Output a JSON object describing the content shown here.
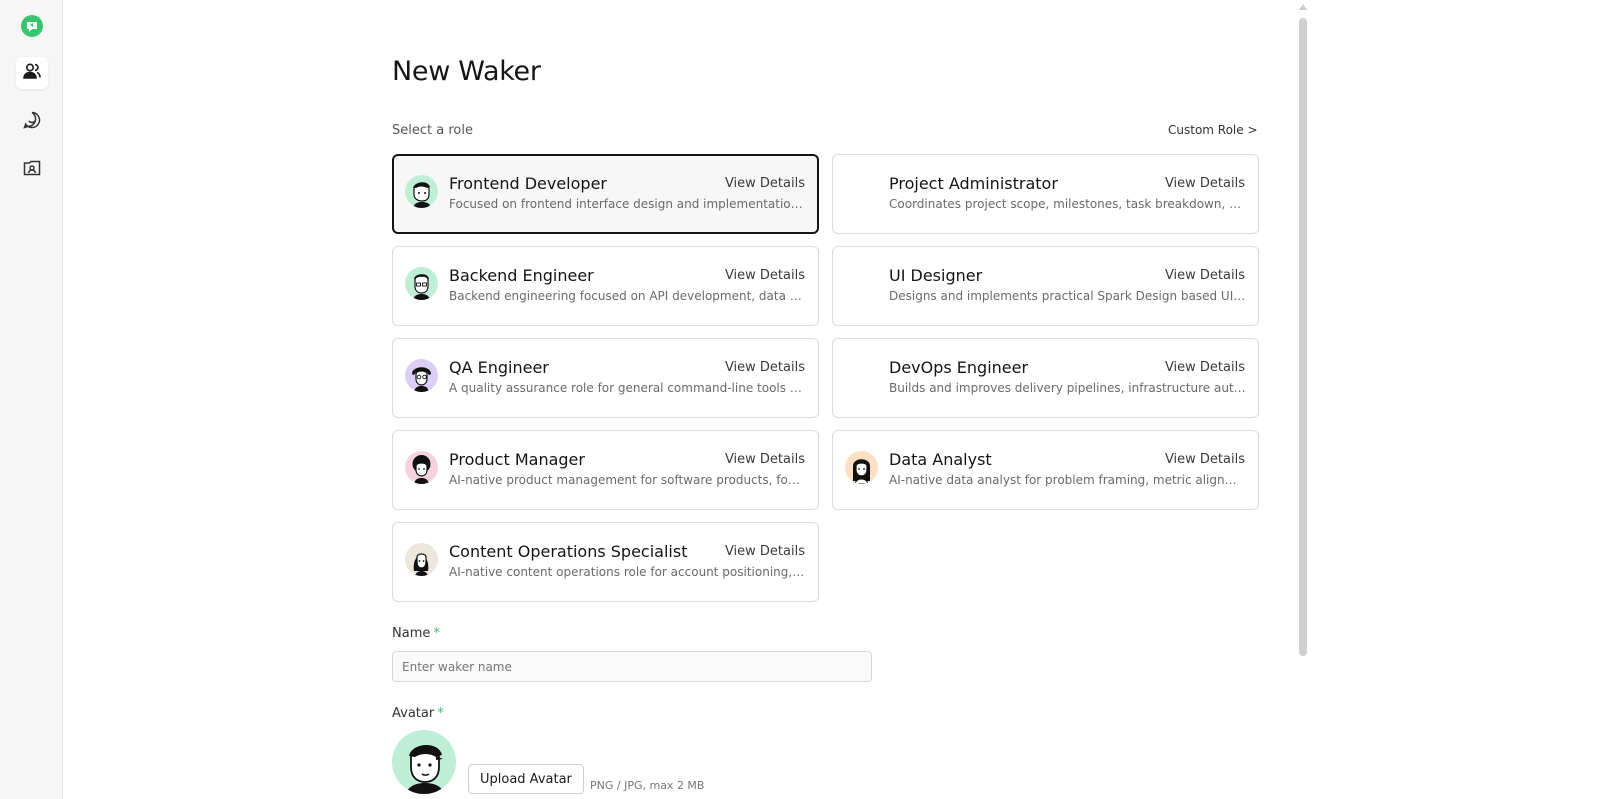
{
  "sidebar": {
    "logo_icon": "app-logo-icon",
    "items": [
      {
        "name": "sidebar-item-wakers",
        "icon": "users-icon",
        "active": true
      },
      {
        "name": "sidebar-item-chat",
        "icon": "chat-bubble-icon",
        "active": false
      },
      {
        "name": "sidebar-item-contacts",
        "icon": "contact-card-icon",
        "active": false
      }
    ]
  },
  "page": {
    "title": "New Waker",
    "select_role_label": "Select a role",
    "custom_role_link": "Custom Role >"
  },
  "roles": [
    {
      "name": "Frontend Developer",
      "view": "View Details",
      "desc": "Focused on frontend interface design and implementation, with a strong emphasis on usability and visual consistency",
      "avatar_bg": "#bfeed7",
      "selected": true
    },
    {
      "name": "Project Administrator",
      "view": "View Details",
      "desc": "Coordinates project scope, milestones, task breakdown, status tracking and team communication",
      "avatar_bg": "",
      "selected": false
    },
    {
      "name": "Backend Engineer",
      "view": "View Details",
      "desc": "Backend engineering focused on API development, data modeling, service reliability and performance",
      "avatar_bg": "#bfeed7",
      "selected": false
    },
    {
      "name": "UI Designer",
      "view": "View Details",
      "desc": "Designs and implements practical Spark Design based UI, mapping requirements into components",
      "avatar_bg": "",
      "selected": false
    },
    {
      "name": "QA Engineer",
      "view": "View Details",
      "desc": "A quality assurance role for general command-line tools and services testing",
      "avatar_bg": "#dccff7",
      "selected": false
    },
    {
      "name": "DevOps Engineer",
      "view": "View Details",
      "desc": "Builds and improves delivery pipelines, infrastructure automation and observability",
      "avatar_bg": "",
      "selected": false
    },
    {
      "name": "Product Manager",
      "view": "View Details",
      "desc": "AI-native product management for software products, focused on discovery and delivery",
      "avatar_bg": "#f6d2de",
      "selected": false
    },
    {
      "name": "Data Analyst",
      "view": "View Details",
      "desc": "AI-native data analyst for problem framing, metric alignment, analysis and reporting",
      "avatar_bg": "#fbe0c4",
      "selected": false
    },
    {
      "name": "Content Operations Specialist",
      "view": "View Details",
      "desc": "AI-native content operations role for account positioning, trend research and publishing",
      "avatar_bg": "#ece7dc",
      "selected": false
    }
  ],
  "form": {
    "name_label": "Name",
    "name_placeholder": "Enter waker name",
    "name_value": "",
    "avatar_label": "Avatar",
    "required_mark": "*",
    "upload_button": "Upload Avatar",
    "upload_hint": "PNG / JPG, max 2 MB"
  },
  "colors": {
    "accent": "#3cbf7a",
    "selected_border": "#141414",
    "card_border": "#dcdcdc",
    "sidebar_bg": "#f6f6f6"
  }
}
